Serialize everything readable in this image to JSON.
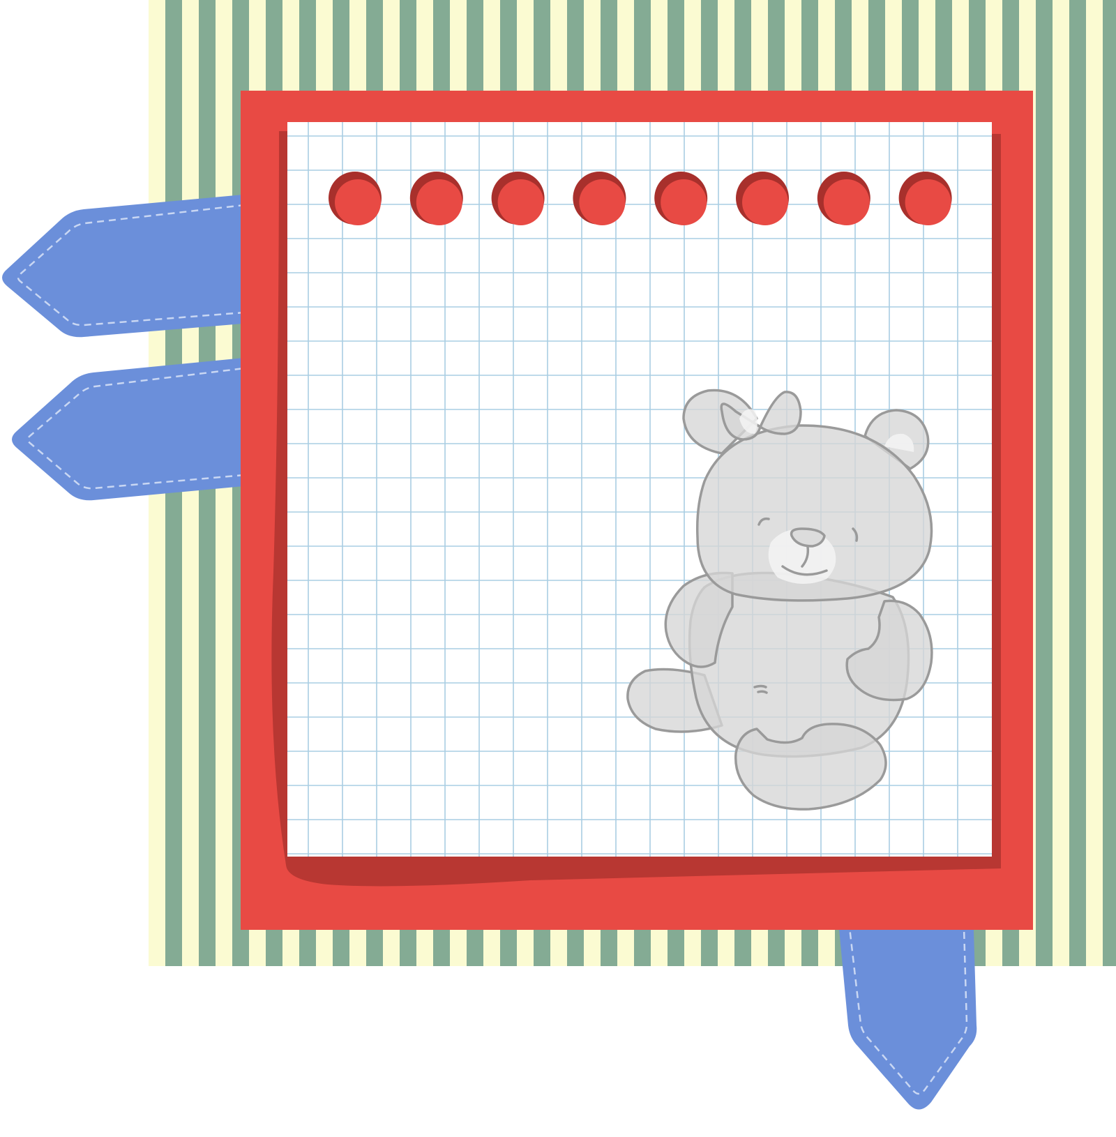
{
  "illustration": {
    "description_free": true,
    "colors": {
      "background": "#ffffff",
      "stripe_green": "#84ab94",
      "stripe_cream": "#fbfbd2",
      "frame_red": "#e84a44",
      "frame_shadow": "#b83732",
      "paper": "#ffffff",
      "grid_line": "#a9cde3",
      "ribbon_blue": "#6b8fda",
      "ribbon_blue_dark": "#5a7cc7",
      "stitch": "#c9d7f3",
      "hole_dark": "#a8302c",
      "hole_red": "#e84a44",
      "bear_fill": "#d6d6d6",
      "bear_outline": "#9a9a9a",
      "bear_highlight": "#f4f4f4"
    },
    "binder_hole_count": 8,
    "ribbons": [
      "left-upper",
      "left-lower",
      "bottom-right"
    ],
    "decoration": "teddy-bear"
  }
}
